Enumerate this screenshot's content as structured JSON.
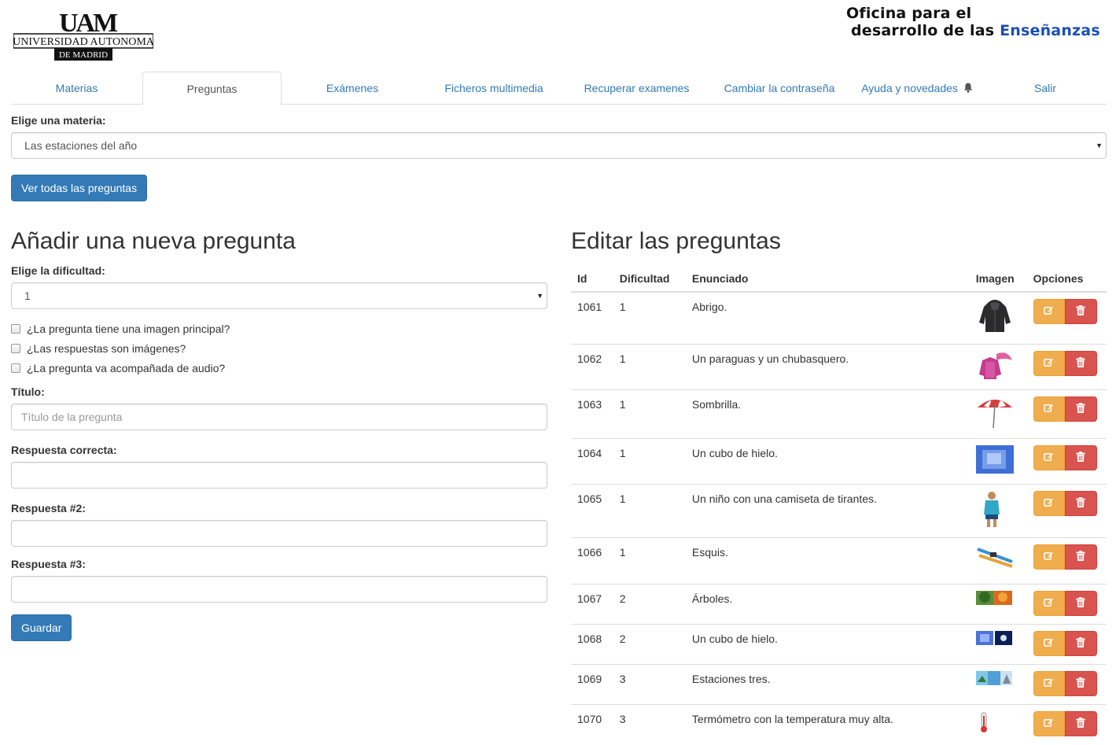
{
  "header": {
    "university_logo_text": [
      "UAM",
      "UNIVERSIDAD AUTONOMA",
      "DE MADRID"
    ],
    "office_line1": "Oficina para el",
    "office_line2": "desarrollo de las ",
    "office_line2_accent": "Enseñanzas"
  },
  "nav": {
    "tabs": [
      {
        "label": "Materias"
      },
      {
        "label": "Preguntas",
        "active": true
      },
      {
        "label": "Exámenes"
      },
      {
        "label": "Ficheros multimedia"
      },
      {
        "label": "Recuperar examenes"
      },
      {
        "label": "Cambiar la contraseña"
      },
      {
        "label": "Ayuda y novedades",
        "icon": "bell-icon"
      },
      {
        "label": "Salir"
      }
    ]
  },
  "subject": {
    "label": "Elige una materia:",
    "selected": "Las estaciones del año",
    "view_all_button": "Ver todas las preguntas"
  },
  "new_question": {
    "heading": "Añadir una nueva pregunta",
    "difficulty_label": "Elige la dificultad:",
    "difficulty_selected": "1",
    "checkboxes": [
      "¿La pregunta tiene una imagen principal?",
      "¿Las respuestas son imágenes?",
      "¿La pregunta va acompañada de audio?"
    ],
    "title_label": "Título:",
    "title_placeholder": "Título de la pregunta",
    "correct_label": "Respuesta correcta:",
    "answer2_label": "Respuesta #2:",
    "answer3_label": "Respuesta #3:",
    "save_button": "Guardar"
  },
  "edit_questions": {
    "heading": "Editar las preguntas",
    "columns": [
      "Id",
      "Dificultad",
      "Enunciado",
      "Imagen",
      "Opciones"
    ],
    "rows": [
      {
        "id": "1061",
        "difficulty": "1",
        "statement": "Abrigo.",
        "image": "coat-image"
      },
      {
        "id": "1062",
        "difficulty": "1",
        "statement": "Un paraguas y un chubasquero.",
        "image": "umbrella-raincoat-image"
      },
      {
        "id": "1063",
        "difficulty": "1",
        "statement": "Sombrilla.",
        "image": "beach-umbrella-image"
      },
      {
        "id": "1064",
        "difficulty": "1",
        "statement": "Un cubo de hielo.",
        "image": "ice-cube-image"
      },
      {
        "id": "1065",
        "difficulty": "1",
        "statement": "Un niño con una camiseta de tirantes.",
        "image": "child-tank-top-image"
      },
      {
        "id": "1066",
        "difficulty": "1",
        "statement": "Esquis.",
        "image": "skis-image"
      },
      {
        "id": "1067",
        "difficulty": "2",
        "statement": "Árboles.",
        "image": "trees-image"
      },
      {
        "id": "1068",
        "difficulty": "2",
        "statement": "Un cubo de hielo.",
        "image": "ice-cube-pair-image"
      },
      {
        "id": "1069",
        "difficulty": "3",
        "statement": "Estaciones tres.",
        "image": "seasons-image"
      },
      {
        "id": "1070",
        "difficulty": "3",
        "statement": "Termómetro con la temperatura muy alta.",
        "image": "thermometer-image"
      }
    ],
    "edit_icon": "edit-icon",
    "delete_icon": "trash-icon"
  },
  "colors": {
    "link": "#337ab7",
    "primary": "#337ab7",
    "warning": "#f0ad4e",
    "danger": "#d9534f",
    "brand_accent": "#1a4fb5"
  }
}
